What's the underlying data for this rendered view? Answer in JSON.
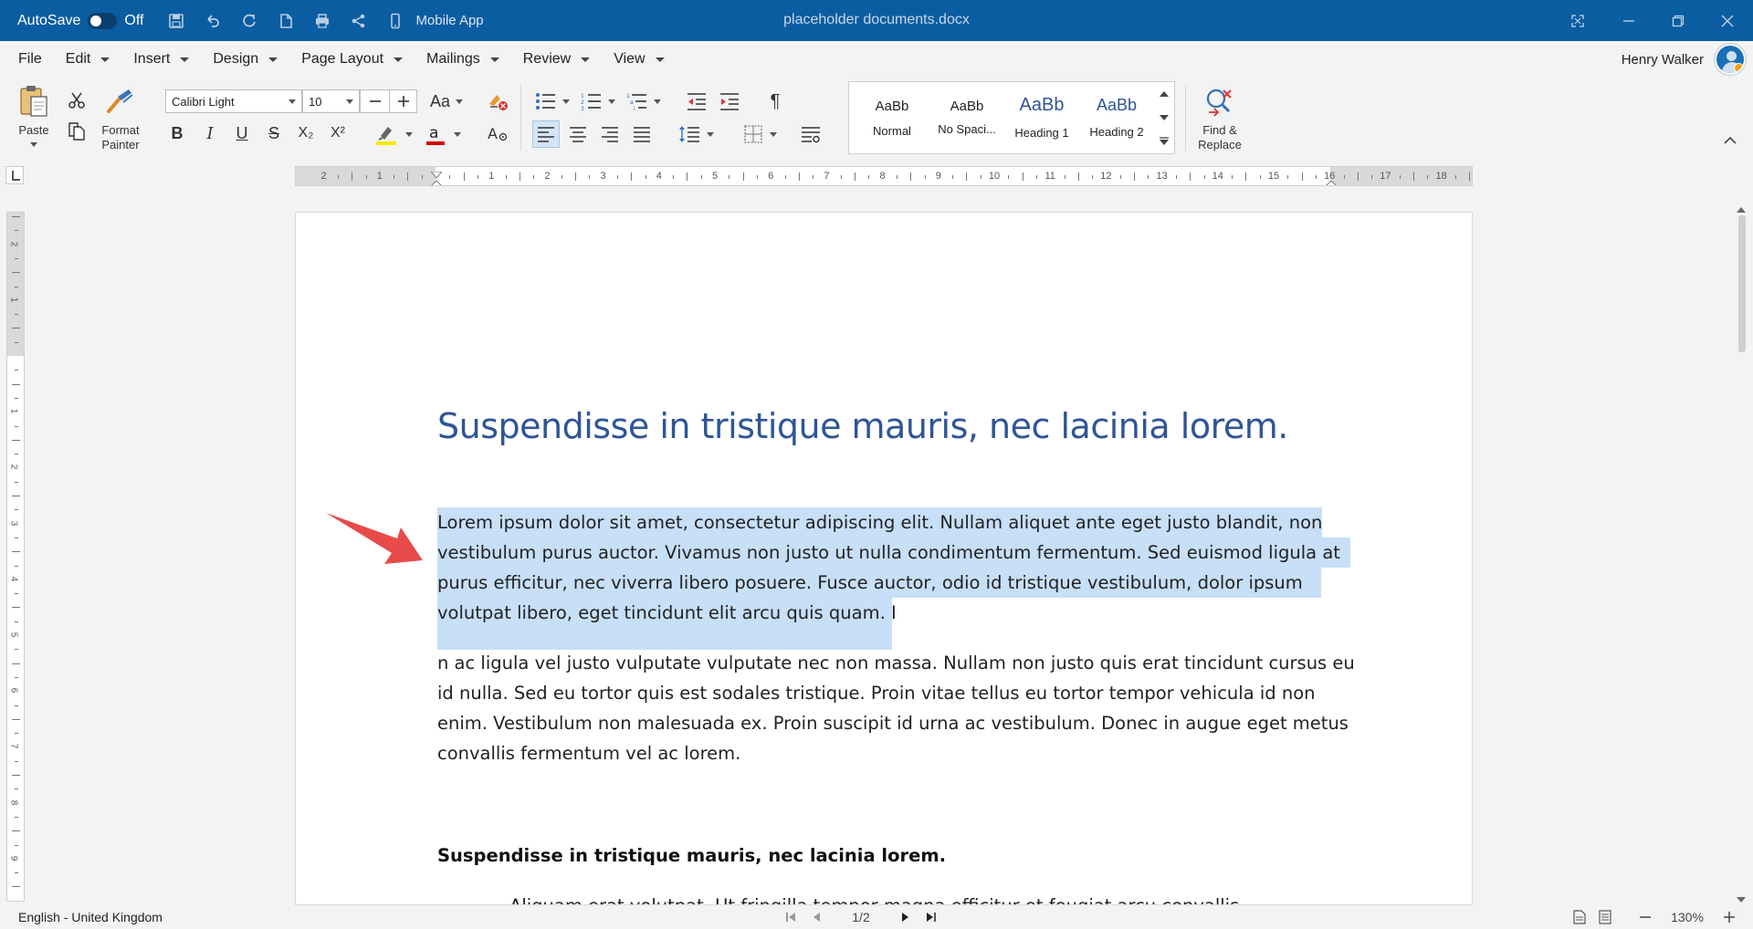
{
  "titlebar": {
    "autosave_label": "AutoSave",
    "autosave_state": "Off",
    "mobile_label": "Mobile App",
    "document_title": "placeholder documents.docx",
    "bar_color": "#0b5da1"
  },
  "menu": {
    "items": [
      {
        "label": "File",
        "has_dropdown": false
      },
      {
        "label": "Edit",
        "has_dropdown": true
      },
      {
        "label": "Insert",
        "has_dropdown": true
      },
      {
        "label": "Design",
        "has_dropdown": true
      },
      {
        "label": "Page Layout",
        "has_dropdown": true
      },
      {
        "label": "Mailings",
        "has_dropdown": true
      },
      {
        "label": "Review",
        "has_dropdown": true
      },
      {
        "label": "View",
        "has_dropdown": true
      }
    ]
  },
  "user": {
    "name": "Henry Walker"
  },
  "ribbon": {
    "paste_label": "Paste",
    "format_painter_label_1": "Format",
    "format_painter_label_2": "Painter",
    "font_name": "Calibri Light",
    "font_size": "10",
    "change_case_label": "Aa",
    "bold_label": "B",
    "italic_label": "I",
    "underline_label": "U",
    "strike_label": "S",
    "subscript_label": "X₂",
    "superscript_label": "X²",
    "pilcrow_label": "¶",
    "highlight_color": "#f5e800",
    "font_color": "#d40000",
    "styles": [
      {
        "sample": "AaBb",
        "name": "Normal"
      },
      {
        "sample": "AaBb",
        "name": "No Spaci..."
      },
      {
        "sample": "AaBb",
        "name": "Heading 1"
      },
      {
        "sample": "AaBb",
        "name": "Heading 2"
      }
    ],
    "find_replace_label_1": "Find &",
    "find_replace_label_2": "Replace"
  },
  "ruler": {
    "h_numbers": [
      "2",
      "1",
      "1",
      "2",
      "3",
      "4",
      "5",
      "6",
      "7",
      "8",
      "9",
      "10",
      "11",
      "12",
      "13",
      "14",
      "15",
      "16",
      "17",
      "18"
    ],
    "v_numbers": [
      "2",
      "1",
      "1",
      "2",
      "3",
      "4",
      "5",
      "6",
      "7",
      "8",
      "9"
    ]
  },
  "document": {
    "heading": "Suspendisse in tristique mauris, nec lacinia lorem.",
    "selected_paragraph_lines": [
      "Lorem ipsum dolor sit amet, consectetur adipiscing elit. Nullam aliquet ante eget justo blandit, non",
      "vestibulum purus auctor. Vivamus non justo ut nulla condimentum fermentum. Sed euismod ligula at",
      "purus efficitur, nec viverra libero posuere. Fusce auctor, odio id tristique vestibulum, dolor ipsum",
      "volutpat libero, eget tincidunt elit arcu quis quam. I"
    ],
    "paragraph2_lines": [
      "n ac ligula vel justo vulputate vulputate nec non massa. Nullam non justo quis erat tincidunt cursus eu",
      "id nulla. Sed eu tortor quis est sodales tristique. Proin vitae tellus eu tortor tempor vehicula id non",
      "enim. Vestibulum non malesuada ex. Proin suscipit id urna ac vestibulum. Donec in augue eget metus",
      "convallis fermentum vel ac lorem."
    ],
    "subheading": "Suspendisse in tristique mauris, nec lacinia lorem.",
    "cutoff_line": "Aliquam erat volutpat. Ut fringilla tempor magna efficitur et feugiat arcu convallis",
    "heading_color": "#2f5597",
    "selection_color": "#c7dff7",
    "annotation_arrow_color": "#e84a4a"
  },
  "status": {
    "language": "English - United Kingdom",
    "page_indicator": "1/2",
    "zoom": "130%"
  }
}
